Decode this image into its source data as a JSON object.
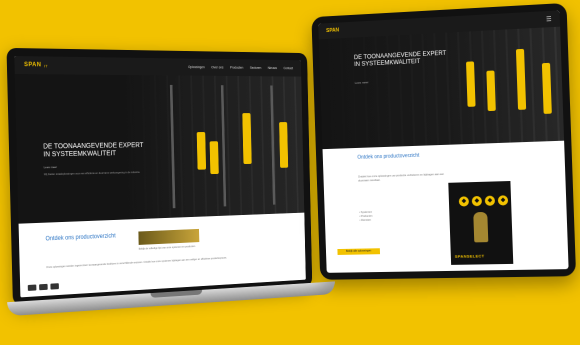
{
  "laptop": {
    "logo": "SPAN",
    "logo_sub": "IT",
    "nav": [
      "Oplossingen",
      "Over ons",
      "Producten",
      "Sectoren",
      "Nieuws",
      "Contact"
    ],
    "hero_title": "DE TOONAANGEVENDE EXPERT IN SYSTEEMKWALITEIT",
    "hero_sub": "Lees meer",
    "hero_body": "Wij bieden totaaloplossingen voor een efficiënte en duurzame werkomgeving in de industrie.",
    "section_title": "Ontdek ons productoverzicht",
    "gold_caption": "Bekijk de volledige lijst van onze systemen en producten.",
    "paragraph": "Onze oplossingen worden ingezet door toonaangevende bedrijven in verschillende sectoren. Ontdek hoe onze systemen bijdragen aan een veiliger en efficiënter productieproces."
  },
  "tablet": {
    "logo": "SPAN",
    "menu_icon": "menu-icon",
    "hero_title": "DE TOONAANGEVENDE EXPERT IN SYSTEEMKWALITEIT",
    "hero_sub": "Lees meer",
    "section_title": "Ontdek ons productoverzicht",
    "paragraph": "Ontdek hoe onze oplossingen uw productie verbeteren en bijdragen aan een duurzaam resultaat.",
    "list": [
      "• Systemen",
      "• Producten",
      "• Diensten"
    ],
    "cta": "Bekijk alle oplossingen",
    "promo_brand": "SPANSELECT",
    "promo_icon_glyphs": [
      "◆",
      "◆",
      "◆",
      "◆"
    ]
  },
  "colors": {
    "background": "#f2c200",
    "accent": "#f2c200",
    "link": "#2b74c4"
  }
}
